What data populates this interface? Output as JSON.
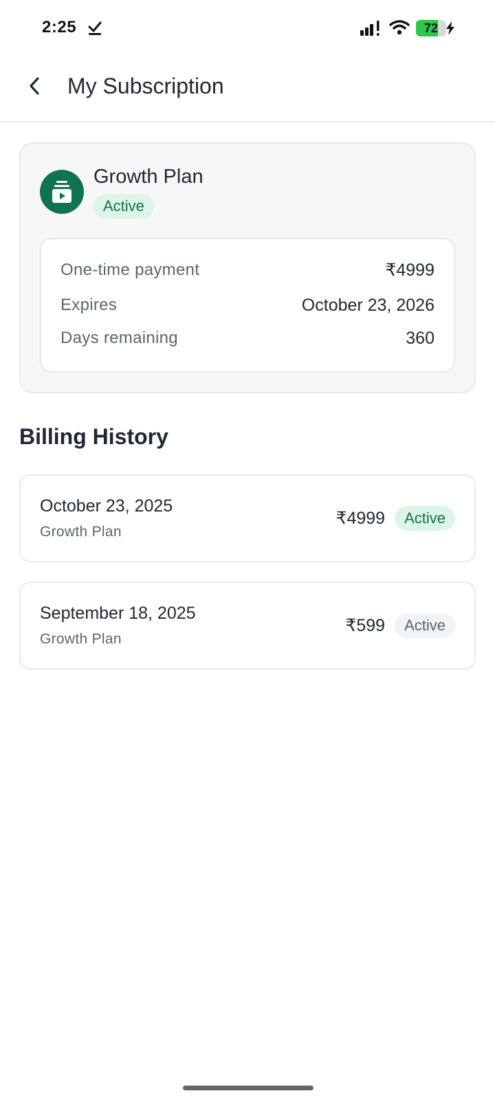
{
  "status_bar": {
    "time": "2:25",
    "battery": "72",
    "battery_percent": 72
  },
  "header": {
    "title": "My Subscription"
  },
  "plan": {
    "name": "Growth Plan",
    "status": "Active",
    "details": [
      {
        "label": "One-time payment",
        "value": "₹4999"
      },
      {
        "label": "Expires",
        "value": "October 23, 2026"
      },
      {
        "label": "Days remaining",
        "value": "360"
      }
    ]
  },
  "billing": {
    "title": "Billing History",
    "items": [
      {
        "date": "October 23, 2025",
        "plan": "Growth Plan",
        "amount": "₹4999",
        "status": "Active",
        "status_style": "green"
      },
      {
        "date": "September 18, 2025",
        "plan": "Growth Plan",
        "amount": "₹599",
        "status": "Active",
        "status_style": "gray"
      }
    ]
  },
  "colors": {
    "brand_green": "#10734f",
    "badge_green_bg": "#dcf5e8",
    "badge_gray_bg": "#f1f3f5",
    "battery_green": "#2bc84d"
  },
  "icons": {
    "back": "chevron-left-icon",
    "plan": "subscription-play-icon",
    "status_check": "check-icon",
    "signal": "signal-icon",
    "wifi": "wifi-icon",
    "battery": "battery-icon",
    "charging": "bolt-icon"
  }
}
